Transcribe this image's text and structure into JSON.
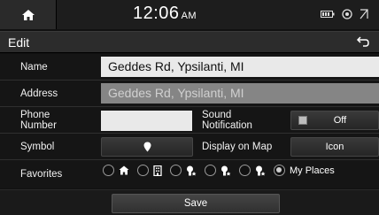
{
  "status": {
    "time": "12:06",
    "ampm": "AM",
    "icons": [
      "battery-icon",
      "signal-icon",
      "network-icon"
    ]
  },
  "header": {
    "title": "Edit",
    "back_icon": "back-arrow-icon",
    "home_icon": "home-icon"
  },
  "form": {
    "name_label": "Name",
    "name_value": "Geddes Rd, Ypsilanti, MI",
    "address_label": "Address",
    "address_value": "Geddes Rd, Ypsilanti, MI",
    "phone_label_1": "Phone",
    "phone_label_2": "Number",
    "phone_value": "",
    "sound_label_1": "Sound",
    "sound_label_2": "Notification",
    "sound_value": "Off",
    "symbol_label": "Symbol",
    "symbol_icon": "map-pin-icon",
    "display_label": "Display on Map",
    "display_value": "Icon",
    "favorites_label": "Favorites",
    "favorites": [
      {
        "icon": "home-icon",
        "selected": false
      },
      {
        "icon": "building-icon",
        "selected": false
      },
      {
        "icon": "person-star-1-icon",
        "selected": false
      },
      {
        "icon": "person-star-2-icon",
        "selected": false
      },
      {
        "icon": "person-star-3-icon",
        "selected": false
      },
      {
        "label": "My Places",
        "selected": true
      }
    ]
  },
  "footer": {
    "save_label": "Save"
  },
  "colors": {
    "field_bg": "#e9e9e9",
    "disabled_field_bg": "#858585",
    "background": "#151515"
  }
}
